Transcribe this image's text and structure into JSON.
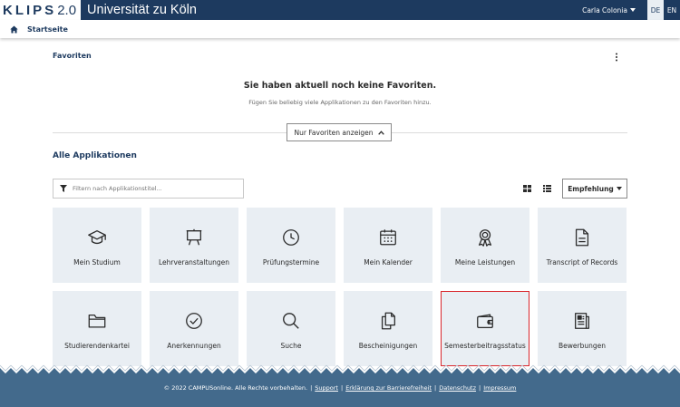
{
  "header": {
    "logo_text": "KLIPS",
    "logo_version": "2.0",
    "university": "Universität zu Köln",
    "user_name": "Carla Colonia",
    "languages": [
      "DE",
      "EN"
    ],
    "active_language": "DE",
    "brand_color": "#1d3a5f"
  },
  "breadcrumb": {
    "home_label": "Startseite"
  },
  "favorites": {
    "title": "Favoriten",
    "empty_title": "Sie haben aktuell noch keine Favoriten.",
    "empty_hint": "Fügen Sie beliebig viele Applikationen zu den Favoriten hinzu.",
    "toggle_label": "Nur Favoriten anzeigen"
  },
  "apps": {
    "title": "Alle Applikationen",
    "filter_placeholder": "Filtern nach Applikationstitel...",
    "sort_label": "Empfehlung",
    "tiles": [
      {
        "label": "Mein Studium",
        "icon": "graduation-cap-icon"
      },
      {
        "label": "Lehrveranstaltungen",
        "icon": "easel-icon"
      },
      {
        "label": "Prüfungstermine",
        "icon": "clock-icon"
      },
      {
        "label": "Mein Kalender",
        "icon": "calendar-icon"
      },
      {
        "label": "Meine Leistungen",
        "icon": "award-icon"
      },
      {
        "label": "Transcript of Records",
        "icon": "document-icon"
      },
      {
        "label": "Studierendenkartei",
        "icon": "folder-icon"
      },
      {
        "label": "Anerkennungen",
        "icon": "check-circle-icon"
      },
      {
        "label": "Suche",
        "icon": "search-icon"
      },
      {
        "label": "Bescheinigungen",
        "icon": "copy-documents-icon"
      },
      {
        "label": "Semesterbeitragsstatus",
        "icon": "wallet-icon"
      },
      {
        "label": "Bewerbungen",
        "icon": "newspaper-icon"
      }
    ],
    "selected_tile": "Semesterbeitragsstatus",
    "selection_color": "#d9262b",
    "tile_color": "#e9eef3"
  },
  "footer": {
    "copyright": "© 2022 CAMPUSonline. Alle Rechte vorbehalten.",
    "links": [
      "Support",
      "Erklärung zur Barrierefreiheit",
      "Datenschutz",
      "Impressum"
    ],
    "background": "#436a8c"
  }
}
